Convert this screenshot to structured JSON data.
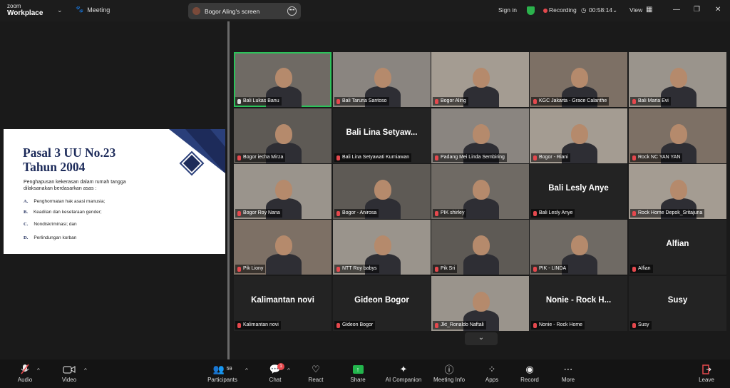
{
  "app": {
    "logo_top": "zoom",
    "logo_bottom": "Workplace",
    "meeting_label": "Meeting"
  },
  "screen_share": {
    "label": "Bogor Aling's screen"
  },
  "top_right": {
    "sign_in": "Sign in",
    "recording": "Recording",
    "timer": "00:58:14",
    "view": "View"
  },
  "slide": {
    "title_line1": "Pasal 3 UU No.23",
    "title_line2": "Tahun 2004",
    "intro": "Penghapusan kekerasan dalam rumah tangga dilaksanakan berdasarkan asas :",
    "items": [
      {
        "key": "A.",
        "text": "Penghormatan hak asasi manusia;"
      },
      {
        "key": "B.",
        "text": "Keadilan dan kesetaraan gender;"
      },
      {
        "key": "C.",
        "text": "Nondiskriminasi; dan"
      },
      {
        "key": "D.",
        "text": "Perlindungan korban"
      }
    ],
    "colors": {
      "navy": "#1d2b5a",
      "accent": "#2a3f7a"
    }
  },
  "participants": [
    {
      "name": "Bali Lukas Banu",
      "bigname": "",
      "video": true,
      "muted": false,
      "active": true
    },
    {
      "name": "Bali Taruna Santoso",
      "bigname": "",
      "video": true,
      "muted": true,
      "active": false
    },
    {
      "name": "Bogor Aling",
      "bigname": "",
      "video": true,
      "muted": true,
      "active": false
    },
    {
      "name": "KGC Jakarta - Grace Calanthe",
      "bigname": "",
      "video": true,
      "muted": true,
      "active": false
    },
    {
      "name": "Bali Maria Evi",
      "bigname": "",
      "video": true,
      "muted": true,
      "active": false
    },
    {
      "name": "Bogor iecha Mirza",
      "bigname": "",
      "video": true,
      "muted": true,
      "active": false
    },
    {
      "name": "Bali Lina Setyawati Kurniawan",
      "bigname": "Bali Lina Setyaw...",
      "video": false,
      "muted": true,
      "active": false
    },
    {
      "name": "Padang Mei Linda Sembiring",
      "bigname": "",
      "video": true,
      "muted": true,
      "active": false
    },
    {
      "name": "Bogor - Riani",
      "bigname": "",
      "video": true,
      "muted": true,
      "active": false
    },
    {
      "name": "Rock NC YAN YAN",
      "bigname": "",
      "video": true,
      "muted": true,
      "active": false
    },
    {
      "name": "Bogor Roy Nana",
      "bigname": "",
      "video": true,
      "muted": true,
      "active": false
    },
    {
      "name": "Bogor - Anirosa",
      "bigname": "",
      "video": true,
      "muted": true,
      "active": false
    },
    {
      "name": "PIK shirley",
      "bigname": "",
      "video": true,
      "muted": true,
      "active": false
    },
    {
      "name": "Bali Lesly Anye",
      "bigname": "Bali Lesly Anye",
      "video": false,
      "muted": true,
      "active": false
    },
    {
      "name": "Rock Home Depok_Sritajuna",
      "bigname": "",
      "video": true,
      "muted": true,
      "active": false
    },
    {
      "name": "Pik Liony",
      "bigname": "",
      "video": true,
      "muted": true,
      "active": false
    },
    {
      "name": "NTT Roy babys",
      "bigname": "",
      "video": true,
      "muted": true,
      "active": false
    },
    {
      "name": "Pik Sri",
      "bigname": "",
      "video": true,
      "muted": true,
      "active": false
    },
    {
      "name": "PIK - LINDA",
      "bigname": "",
      "video": true,
      "muted": true,
      "active": false
    },
    {
      "name": "Alfian",
      "bigname": "Alfian",
      "video": false,
      "muted": true,
      "active": false
    },
    {
      "name": "Kalimantan novi",
      "bigname": "Kalimantan novi",
      "video": false,
      "muted": true,
      "active": false
    },
    {
      "name": "Gideon Bogor",
      "bigname": "Gideon Bogor",
      "video": false,
      "muted": true,
      "active": false
    },
    {
      "name": "Jkt_Ronaldo Naftali",
      "bigname": "",
      "video": true,
      "muted": true,
      "active": false
    },
    {
      "name": "Nonie - Rock Home",
      "bigname": "Nonie - Rock H...",
      "video": false,
      "muted": true,
      "active": false
    },
    {
      "name": "Susy",
      "bigname": "Susy",
      "video": false,
      "muted": true,
      "active": false
    }
  ],
  "toolbar": {
    "audio": "Audio",
    "video": "Video",
    "participants": "Participants",
    "participants_count": "59",
    "chat": "Chat",
    "chat_badge": "1",
    "react": "React",
    "share": "Share",
    "ai": "AI Companion",
    "info": "Meeting Info",
    "apps": "Apps",
    "record": "Record",
    "more": "More",
    "leave": "Leave"
  }
}
